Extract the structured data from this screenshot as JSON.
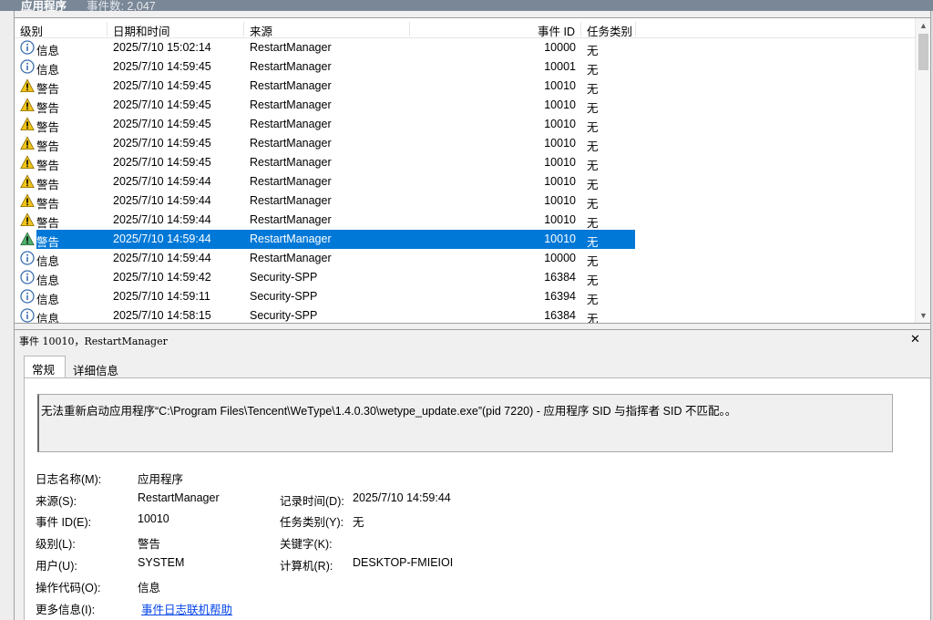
{
  "window": {
    "title": "应用程序",
    "event_count": "事件数: 2,047"
  },
  "columns": [
    "级别",
    "日期和时间",
    "来源",
    "事件 ID",
    "任务类别"
  ],
  "events": [
    {
      "level": "信息",
      "type": "info",
      "datetime": "2025/7/10 15:02:14",
      "source": "RestartManager",
      "event_id": "10000",
      "task": "无"
    },
    {
      "level": "信息",
      "type": "info",
      "datetime": "2025/7/10 14:59:45",
      "source": "RestartManager",
      "event_id": "10001",
      "task": "无"
    },
    {
      "level": "警告",
      "type": "warning",
      "datetime": "2025/7/10 14:59:45",
      "source": "RestartManager",
      "event_id": "10010",
      "task": "无"
    },
    {
      "level": "警告",
      "type": "warning",
      "datetime": "2025/7/10 14:59:45",
      "source": "RestartManager",
      "event_id": "10010",
      "task": "无"
    },
    {
      "level": "警告",
      "type": "warning",
      "datetime": "2025/7/10 14:59:45",
      "source": "RestartManager",
      "event_id": "10010",
      "task": "无"
    },
    {
      "level": "警告",
      "type": "warning",
      "datetime": "2025/7/10 14:59:45",
      "source": "RestartManager",
      "event_id": "10010",
      "task": "无"
    },
    {
      "level": "警告",
      "type": "warning",
      "datetime": "2025/7/10 14:59:45",
      "source": "RestartManager",
      "event_id": "10010",
      "task": "无"
    },
    {
      "level": "警告",
      "type": "warning",
      "datetime": "2025/7/10 14:59:44",
      "source": "RestartManager",
      "event_id": "10010",
      "task": "无"
    },
    {
      "level": "警告",
      "type": "warning",
      "datetime": "2025/7/10 14:59:44",
      "source": "RestartManager",
      "event_id": "10010",
      "task": "无"
    },
    {
      "level": "警告",
      "type": "warning",
      "datetime": "2025/7/10 14:59:44",
      "source": "RestartManager",
      "event_id": "10010",
      "task": "无"
    },
    {
      "level": "警告",
      "type": "warning",
      "datetime": "2025/7/10 14:59:44",
      "source": "RestartManager",
      "event_id": "10010",
      "task": "无",
      "selected": true
    },
    {
      "level": "信息",
      "type": "info",
      "datetime": "2025/7/10 14:59:44",
      "source": "RestartManager",
      "event_id": "10000",
      "task": "无"
    },
    {
      "level": "信息",
      "type": "info",
      "datetime": "2025/7/10 14:59:42",
      "source": "Security-SPP",
      "event_id": "16384",
      "task": "无"
    },
    {
      "level": "信息",
      "type": "info",
      "datetime": "2025/7/10 14:59:11",
      "source": "Security-SPP",
      "event_id": "16394",
      "task": "无"
    },
    {
      "level": "信息",
      "type": "info",
      "datetime": "2025/7/10 14:58:15",
      "source": "Security-SPP",
      "event_id": "16384",
      "task": "无"
    }
  ],
  "detail": {
    "header": "事件 10010，RestartManager",
    "tabs": [
      "常规",
      "详细信息"
    ],
    "message": "无法重新启动应用程序“C:\\Program Files\\Tencent\\WeType\\1.4.0.30\\wetype_update.exe”(pid 7220) - 应用程序 SID 与指挥者 SID 不匹配。。",
    "fields": {
      "log_name_label": "日志名称(M):",
      "log_name": "应用程序",
      "source_label": "来源(S):",
      "source": "RestartManager",
      "logged_label": "记录时间(D):",
      "logged": "2025/7/10 14:59:44",
      "event_id_label": "事件 ID(E):",
      "event_id": "10010",
      "task_label": "任务类别(Y):",
      "task": "无",
      "level_label": "级别(L):",
      "level": "警告",
      "keywords_label": "关键字(K):",
      "keywords": "",
      "user_label": "用户(U):",
      "user": "SYSTEM",
      "computer_label": "计算机(R):",
      "computer": "DESKTOP-FMIEIOI",
      "opcode_label": "操作代码(O):",
      "opcode": "信息",
      "more_info_label": "更多信息(I):",
      "more_info_link": "事件日志联机帮助"
    }
  },
  "colors": {
    "selection": "#0078d7",
    "info_icon": "#3a6fb0",
    "warning_icon": "#f0c419",
    "link": "#0645e8"
  },
  "icons": {
    "info": "info-icon",
    "warning": "warning-icon",
    "close": "close-icon"
  }
}
